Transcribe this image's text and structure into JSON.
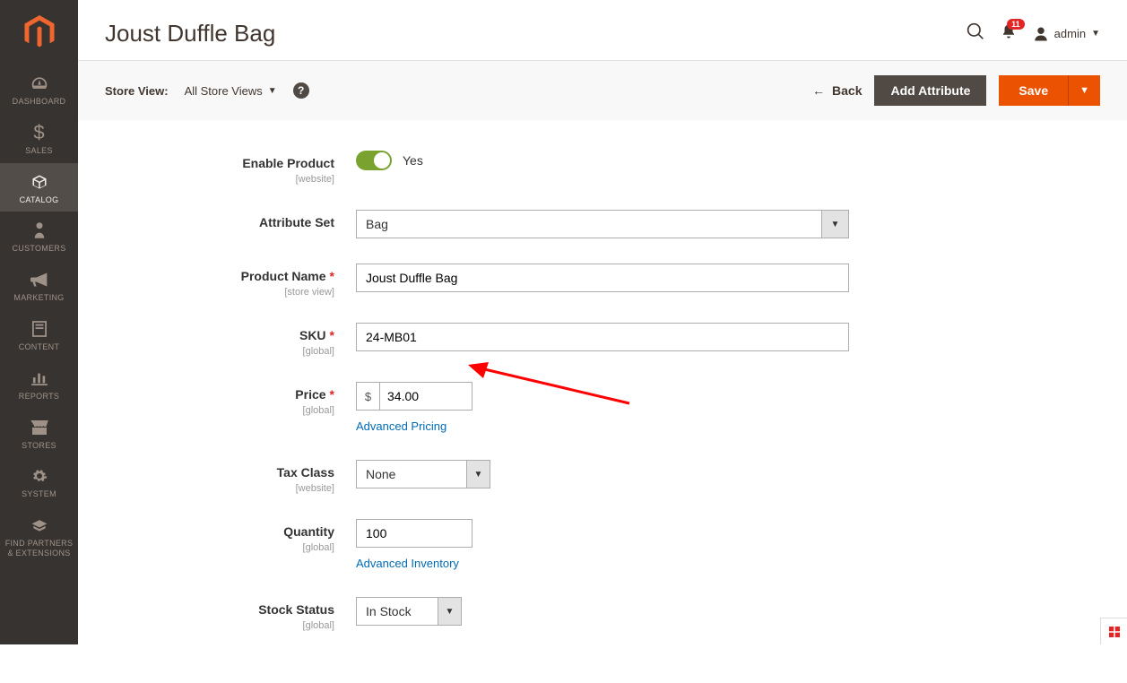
{
  "sidebar": {
    "items": [
      {
        "label": "DASHBOARD"
      },
      {
        "label": "SALES"
      },
      {
        "label": "CATALOG"
      },
      {
        "label": "CUSTOMERS"
      },
      {
        "label": "MARKETING"
      },
      {
        "label": "CONTENT"
      },
      {
        "label": "REPORTS"
      },
      {
        "label": "STORES"
      },
      {
        "label": "SYSTEM"
      },
      {
        "label": "FIND PARTNERS & EXTENSIONS"
      }
    ]
  },
  "header": {
    "title": "Joust Duffle Bag",
    "notifications": "11",
    "username": "admin"
  },
  "toolbar": {
    "store_view_label": "Store View:",
    "store_view_value": "All Store Views",
    "back_label": "Back",
    "add_attribute_label": "Add Attribute",
    "save_label": "Save"
  },
  "form": {
    "enable_product": {
      "label": "Enable Product",
      "scope": "[website]",
      "value": "Yes"
    },
    "attribute_set": {
      "label": "Attribute Set",
      "value": "Bag"
    },
    "product_name": {
      "label": "Product Name",
      "scope": "[store view]",
      "value": "Joust Duffle Bag"
    },
    "sku": {
      "label": "SKU",
      "scope": "[global]",
      "value": "24-MB01"
    },
    "price": {
      "label": "Price",
      "scope": "[global]",
      "currency": "$",
      "value": "34.00",
      "link": "Advanced Pricing"
    },
    "tax_class": {
      "label": "Tax Class",
      "scope": "[website]",
      "value": "None"
    },
    "quantity": {
      "label": "Quantity",
      "scope": "[global]",
      "value": "100",
      "link": "Advanced Inventory"
    },
    "stock_status": {
      "label": "Stock Status",
      "scope": "[global]",
      "value": "In Stock"
    }
  }
}
